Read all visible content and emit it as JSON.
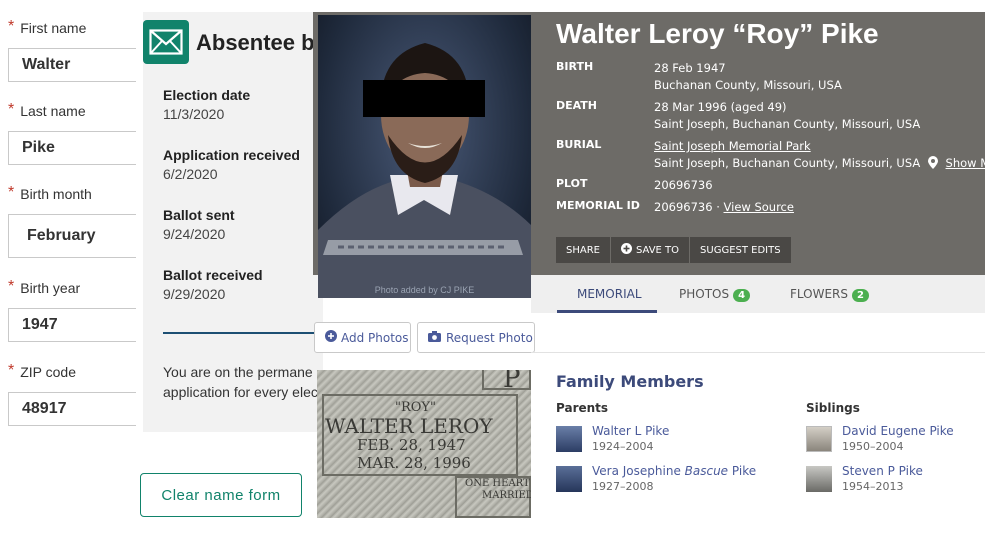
{
  "form": {
    "first_name_label": "First name",
    "first_name_value": "Walter",
    "last_name_label": "Last name",
    "last_name_value": "Pike",
    "birth_month_label": "Birth month",
    "birth_month_value": "February",
    "birth_year_label": "Birth year",
    "birth_year_value": "1947",
    "zip_label": "ZIP code",
    "zip_value": "48917",
    "required_marker": "*",
    "clear_button": "Clear name form"
  },
  "absentee": {
    "title": "Absentee b",
    "election_date_label": "Election date",
    "election_date_value": "11/3/2020",
    "app_received_label": "Application received",
    "app_received_value": "6/2/2020",
    "ballot_sent_label": "Ballot sent",
    "ballot_sent_value": "9/24/2020",
    "ballot_received_label": "Ballot received",
    "ballot_received_value": "9/29/2020",
    "permanent_line1": "You are on the permane",
    "permanent_line2": "application for every elec",
    "accent_color": "#11836b"
  },
  "memorial": {
    "name": "Walter Leroy “Roy” Pike",
    "photo_caption": "Photo added by CJ PIKE",
    "birth_label": "BIRTH",
    "birth_date": "28 Feb 1947",
    "birth_place": "Buchanan County, Missouri, USA",
    "death_label": "DEATH",
    "death_date": "28 Mar 1996 (aged 49)",
    "death_place": "Saint Joseph, Buchanan County, Missouri, USA",
    "burial_label": "BURIAL",
    "burial_name": "Saint Joseph Memorial Park",
    "burial_place": "Saint Joseph, Buchanan County, Missouri, USA",
    "show_map": "Show Map",
    "plot_label": "PLOT",
    "plot_value": "20696736",
    "memorial_id_label": "MEMORIAL ID",
    "memorial_id_value": "20696736 ·",
    "view_source": "View Source",
    "actions": {
      "share": "SHARE",
      "save_to": "SAVE TO",
      "suggest_edits": "SUGGEST EDITS"
    },
    "tabs": {
      "memorial": "MEMORIAL",
      "photos": "PHOTOS",
      "photos_count": "4",
      "flowers": "FLOWERS",
      "flowers_count": "2"
    },
    "add_photos": "Add Photos",
    "request_photo": "Request Photo",
    "gravestone": {
      "nickname": "\"ROY\"",
      "name": "WALTER LEROY",
      "born": "FEB. 28, 1947",
      "died": "MAR. 28, 1996",
      "corner_top": "P",
      "inscription1": "ONE HEART",
      "inscription2": "MARRIED"
    },
    "family_title": "Family Members",
    "parents_label": "Parents",
    "siblings_label": "Siblings",
    "parents": [
      {
        "name": "Walter L Pike",
        "dates": "1924–2004"
      },
      {
        "name_pre": "Vera Josephine ",
        "name_italic": "Bascue",
        "name_post": " Pike",
        "dates": "1927–2008"
      }
    ],
    "siblings": [
      {
        "name": "David Eugene Pike",
        "dates": "1950–2004"
      },
      {
        "name": "Steven P Pike",
        "dates": "1954–2013"
      }
    ]
  }
}
